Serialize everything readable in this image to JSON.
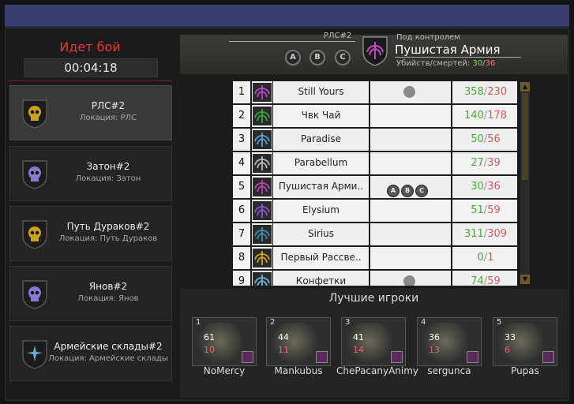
{
  "battle": {
    "status": "Идет бой",
    "timer": "00:04:18"
  },
  "locations": [
    {
      "name": "РЛС#2",
      "sub": "Локация: РЛС",
      "emblem": "skull-gold-icon",
      "color": "#c9a21f"
    },
    {
      "name": "Затон#2",
      "sub": "Локация: Затон",
      "emblem": "skull-violet-icon",
      "color": "#8a7ad6"
    },
    {
      "name": "Путь Дураков#2",
      "sub": "Локация: Путь Дураков",
      "emblem": "skull-gold-icon",
      "color": "#c9a21f"
    },
    {
      "name": "Янов#2",
      "sub": "Локация: Янов",
      "emblem": "skull-violet-icon",
      "color": "#8a7ad6"
    },
    {
      "name": "Армейские склады#2",
      "sub": "Локация: Армейские склады",
      "emblem": "compass-star-icon",
      "color": "#6ab0d6"
    }
  ],
  "point": {
    "title": "РЛС#2",
    "abc": [
      "A",
      "B",
      "C"
    ]
  },
  "control": {
    "label": "Под контролем",
    "name": "Пушистая Армия",
    "kd_label": "Убийств/смертей:",
    "kills": "30",
    "deaths": "36",
    "sep": "/"
  },
  "clans": [
    {
      "rank": "1",
      "name": "Still Yours",
      "kills": "358",
      "deaths": "230",
      "flag": true,
      "abc": false,
      "emblem": "winged-emblem-icon",
      "color": "#b04ad0"
    },
    {
      "rank": "2",
      "name": "Чвк Чай",
      "kills": "140",
      "deaths": "178",
      "flag": false,
      "abc": false,
      "emblem": "winged-emblem-icon",
      "color": "#3aa83a"
    },
    {
      "rank": "3",
      "name": "Paradise",
      "kills": "50",
      "deaths": "56",
      "flag": false,
      "abc": false,
      "emblem": "wings-icon",
      "color": "#5aa0d0"
    },
    {
      "rank": "4",
      "name": "Parabellum",
      "kills": "27",
      "deaths": "39",
      "flag": false,
      "abc": false,
      "emblem": "wings-icon",
      "color": "#bbbbbb"
    },
    {
      "rank": "5",
      "name": "Пушистая Арми..",
      "kills": "30",
      "deaths": "36",
      "flag": false,
      "abc": true,
      "emblem": "wings-icon",
      "color": "#b04ab0"
    },
    {
      "rank": "6",
      "name": "Elysium",
      "kills": "51",
      "deaths": "59",
      "flag": false,
      "abc": false,
      "emblem": "crossed-skull-icon",
      "color": "#8a5ad0"
    },
    {
      "rank": "7",
      "name": "Sirius",
      "kills": "311",
      "deaths": "309",
      "flag": false,
      "abc": false,
      "emblem": "star-emblem-icon",
      "color": "#3a90b0"
    },
    {
      "rank": "8",
      "name": "Первый Рассве..",
      "kills": "0",
      "deaths": "1",
      "flag": false,
      "abc": false,
      "emblem": "wreath-emblem-icon",
      "color": "#c9a21f"
    },
    {
      "rank": "9",
      "name": "Конфетки",
      "kills": "74",
      "deaths": "59",
      "flag": true,
      "abc": false,
      "emblem": "jellyfish-icon",
      "color": "#6ab0d6"
    }
  ],
  "best": {
    "title": "Лучшие игроки",
    "players": [
      {
        "rank": "1",
        "level": "61",
        "kills": "10",
        "name": "NoMercy"
      },
      {
        "rank": "2",
        "level": "44",
        "kills": "11",
        "name": "Mankubus"
      },
      {
        "rank": "3",
        "level": "41",
        "kills": "14",
        "name": "ChePacanyAnimy"
      },
      {
        "rank": "4",
        "level": "36",
        "kills": "13",
        "name": "sergunca"
      },
      {
        "rank": "5",
        "level": "33",
        "kills": "6",
        "name": "Pupas"
      }
    ]
  }
}
